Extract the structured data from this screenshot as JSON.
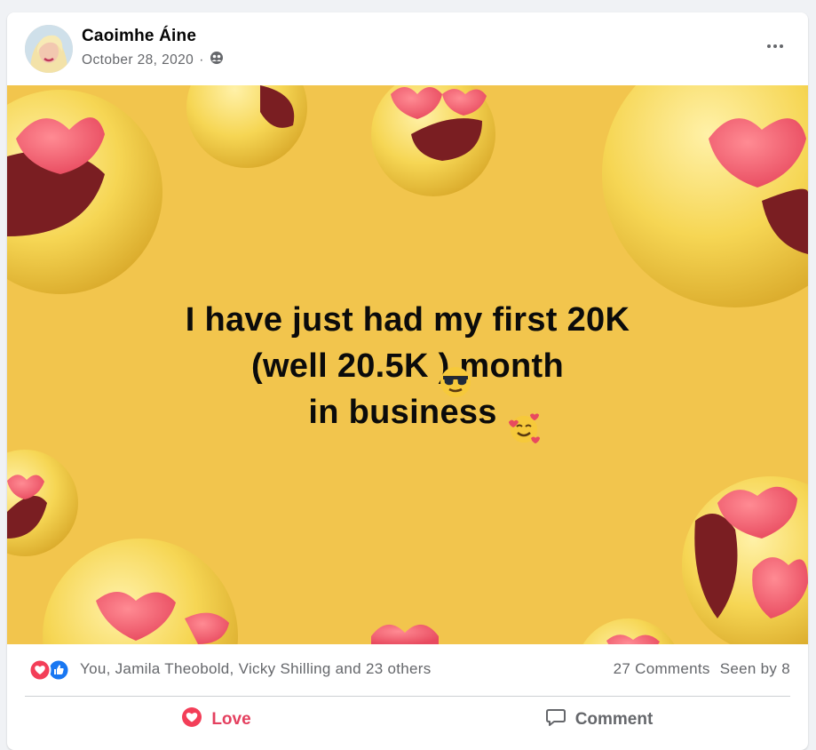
{
  "post": {
    "author": "Caoimhe Áine",
    "date": "October 28, 2020",
    "separator": "·",
    "audience_icon": "friends-icon",
    "more_icon": "more-options-icon"
  },
  "image": {
    "line1": "I have just had my first 20K",
    "line2_prefix": "(well 20.5K",
    "line2_suffix": ") month",
    "line3": "in business",
    "background_color": "#f2c54d"
  },
  "reactions": {
    "icons": [
      "love-reaction-icon",
      "like-reaction-icon"
    ],
    "names": "You, Jamila Theobold, Vicky Shilling and 23 others",
    "comments": "27 Comments",
    "seen": "Seen by 8"
  },
  "actions": {
    "love": "Love",
    "comment": "Comment"
  },
  "colors": {
    "love": "#e4405f",
    "like": "#1877f2",
    "muted": "#65676b"
  }
}
